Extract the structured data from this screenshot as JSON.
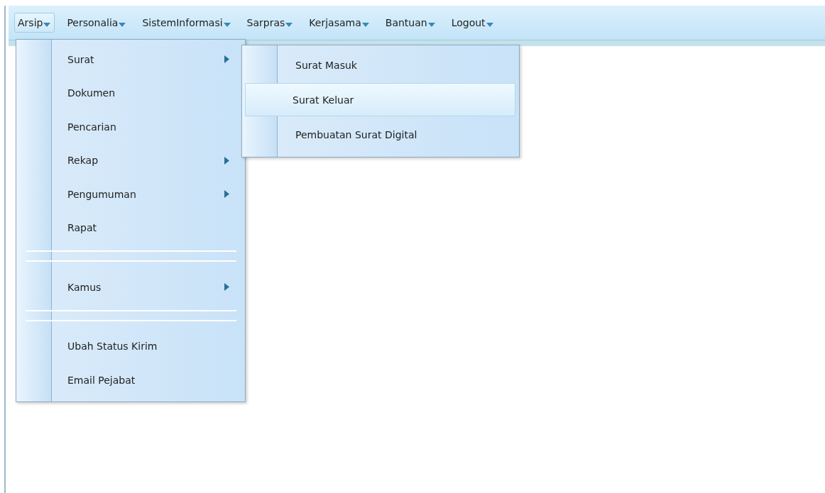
{
  "menubar": [
    {
      "label": "Arsip",
      "selected": true
    },
    {
      "label": "Personalia",
      "selected": false
    },
    {
      "label": "SistemInformasi",
      "selected": false
    },
    {
      "label": "Sarpras",
      "selected": false
    },
    {
      "label": "Kerjasama",
      "selected": false
    },
    {
      "label": "Bantuan",
      "selected": false
    },
    {
      "label": "Logout",
      "selected": false
    }
  ],
  "menu": {
    "items": [
      {
        "kind": "item",
        "label": "Surat",
        "submenu": true
      },
      {
        "kind": "item",
        "label": "Dokumen",
        "submenu": false
      },
      {
        "kind": "item",
        "label": "Pencarian",
        "submenu": false
      },
      {
        "kind": "item",
        "label": "Rekap",
        "submenu": true
      },
      {
        "kind": "item",
        "label": "Pengumuman",
        "submenu": true
      },
      {
        "kind": "item",
        "label": "Rapat",
        "submenu": false
      },
      {
        "kind": "separator"
      },
      {
        "kind": "item",
        "label": "Kamus",
        "submenu": true
      },
      {
        "kind": "separator"
      },
      {
        "kind": "item",
        "label": "Ubah Status Kirim",
        "submenu": false
      },
      {
        "kind": "item",
        "label": "Email Pejabat",
        "submenu": false
      }
    ]
  },
  "submenu": {
    "items": [
      {
        "label": "Surat Masuk",
        "selected": false
      },
      {
        "label": "Surat Keluar",
        "selected": true
      },
      {
        "label": "Pembuatan Surat Digital",
        "selected": false
      }
    ]
  }
}
